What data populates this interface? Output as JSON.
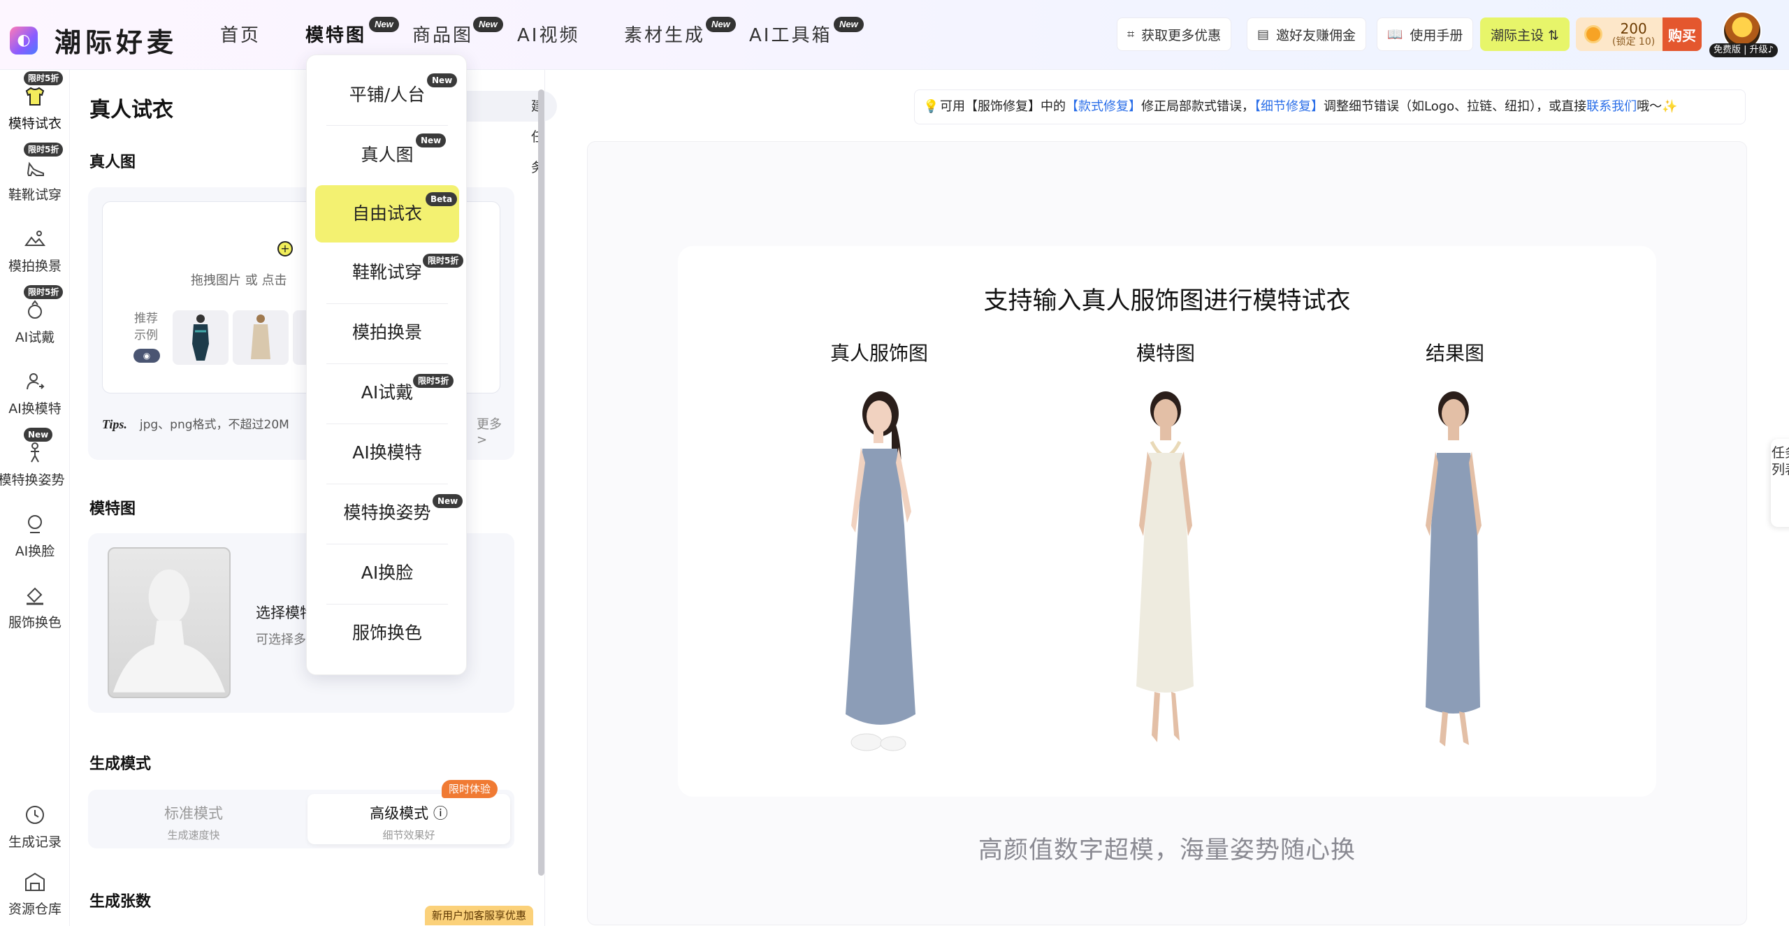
{
  "app": {
    "name": "潮际好麦"
  },
  "nav": {
    "items": [
      {
        "label": "首页"
      },
      {
        "label": "模特图",
        "badge": "New"
      },
      {
        "label": "商品图",
        "badge": "New"
      },
      {
        "label": "AI视频"
      },
      {
        "label": "素材生成",
        "badge": "New"
      },
      {
        "label": "AI工具箱",
        "badge": "New"
      }
    ]
  },
  "header_actions": {
    "more_offers": "获取更多优惠",
    "invite": "邀好友赚佣金",
    "manual": "使用手册",
    "theme": "潮际主设 ⇅",
    "coins": "200",
    "coins_locked": "(锁定 10)",
    "buy": "购买",
    "vip": "免费版 | 升级♪"
  },
  "sidebar": {
    "items": [
      {
        "label": "模特试衣",
        "badge": "限时5折"
      },
      {
        "label": "鞋靴试穿",
        "badge": "限时5折"
      },
      {
        "label": "模拍换景"
      },
      {
        "label": "AI试戴",
        "badge": "限时5折"
      },
      {
        "label": "AI换模特"
      },
      {
        "label": "模特换姿势",
        "badge": "New"
      },
      {
        "label": "AI换脸"
      },
      {
        "label": "服饰换色"
      },
      {
        "label": "生成记录"
      },
      {
        "label": "资源仓库"
      }
    ]
  },
  "panel": {
    "title": "真人试衣",
    "create_task": "建任务",
    "sec_real": "真人图",
    "upload_hint": "拖拽图片 或 点击",
    "upload_plus": "+",
    "recommend": "推荐示例",
    "tips_label": "Tips.",
    "tips_text": "jpg、png格式，不超过20M",
    "tips_more": "更多 >",
    "sec_model": "模特图",
    "model_select": "选择模特",
    "model_sub": "可选择多个",
    "sec_mode": "生成模式",
    "mode_std": "标准模式",
    "mode_std_sub": "生成速度快",
    "mode_adv": "高级模式 ⓘ",
    "mode_adv_sub": "细节效果好",
    "trial_badge": "限时体验",
    "sec_count": "生成张数",
    "newuser": "新用户加客服享优惠"
  },
  "dropdown": {
    "items": [
      {
        "label": "平铺/人台",
        "badge": "New"
      },
      {
        "label": "真人图",
        "badge": "New"
      },
      {
        "label": "自由试衣",
        "badge": "Beta"
      },
      {
        "label": "鞋靴试穿",
        "badge": "限时5折"
      },
      {
        "label": "模拍换景"
      },
      {
        "label": "AI试戴",
        "badge": "限时5折"
      },
      {
        "label": "AI换模特"
      },
      {
        "label": "模特换姿势",
        "badge": "New"
      },
      {
        "label": "AI换脸"
      },
      {
        "label": "服饰换色"
      }
    ]
  },
  "notice": {
    "p1": "可用【服饰修复】中的",
    "l1": "【款式修复】",
    "p2": "修正局部款式错误，",
    "l2": "【细节修复】",
    "p3": "调整细节错误（如Logo、拉链、纽扣），或直接",
    "l3": "联系我们",
    "p4": "哦～✨"
  },
  "demo": {
    "title": "支持输入真人服饰图进行模特试衣",
    "col1": "真人服饰图",
    "col2": "模特图",
    "col3": "结果图",
    "subtitle": "高颜值数字超模，海量姿势随心换"
  },
  "side_tab": "任务列表",
  "colors": {
    "accent_yellow": "#f3f171",
    "badge_dark": "#333333",
    "link_blue": "#2a6ee8",
    "trial_orange": "#f07a33"
  }
}
